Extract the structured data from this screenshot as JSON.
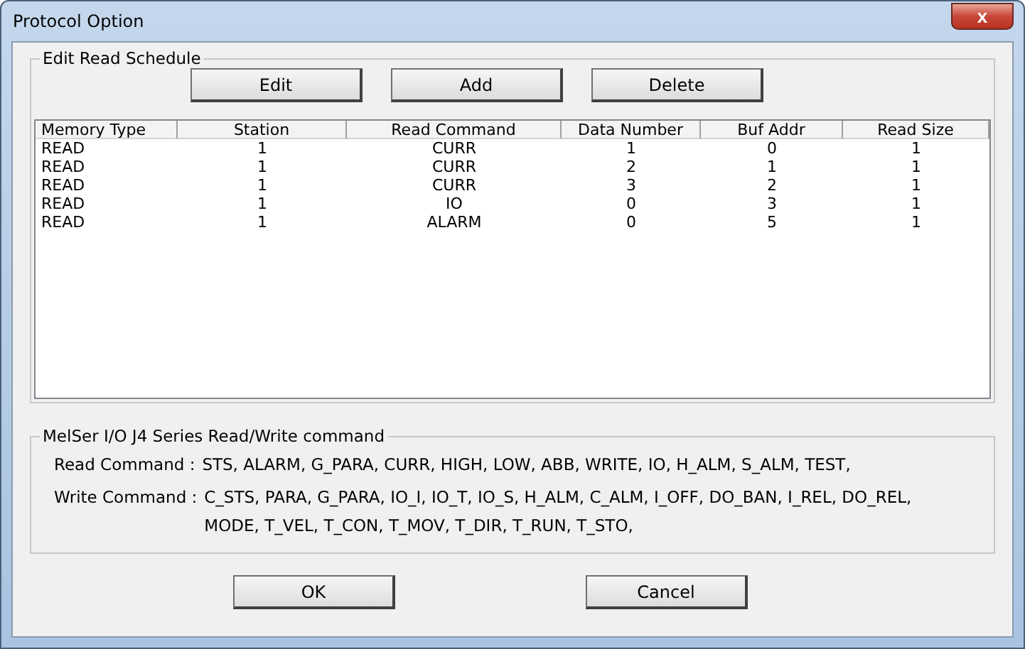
{
  "window": {
    "title": "Protocol Option",
    "close": "x"
  },
  "schedule": {
    "title": "Edit Read Schedule",
    "buttons": [
      "Edit",
      "Add",
      "Delete"
    ],
    "columns": [
      "Memory Type",
      "Station",
      "Read Command",
      "Data Number",
      "Buf Addr",
      "Read Size"
    ],
    "rows": [
      [
        "READ",
        "1",
        "CURR",
        "1",
        "0",
        "1"
      ],
      [
        "READ",
        "1",
        "CURR",
        "2",
        "1",
        "1"
      ],
      [
        "READ",
        "1",
        "CURR",
        "3",
        "2",
        "1"
      ],
      [
        "READ",
        "1",
        "IO",
        "0",
        "3",
        "1"
      ],
      [
        "READ",
        "1",
        "ALARM",
        "0",
        "5",
        "1"
      ]
    ]
  },
  "commands": {
    "title": "MelSer I/O J4 Series Read/Write command",
    "lines": [
      {
        "label": "Read Command :",
        "values": [
          "STS, ALARM, G_PARA, CURR, HIGH, LOW, ABB, WRITE, IO, H_ALM, S_ALM, TEST,"
        ]
      },
      {
        "label": "Write Command :",
        "values": [
          "C_STS, PARA, G_PARA, IO_I, IO_T, IO_S, H_ALM, C_ALM, I_OFF, DO_BAN, I_REL, DO_REL,",
          "MODE, T_VEL, T_CON, T_MOV, T_DIR, T_RUN, T_STO,"
        ]
      }
    ]
  },
  "buttons": [
    "OK",
    "Cancel"
  ]
}
